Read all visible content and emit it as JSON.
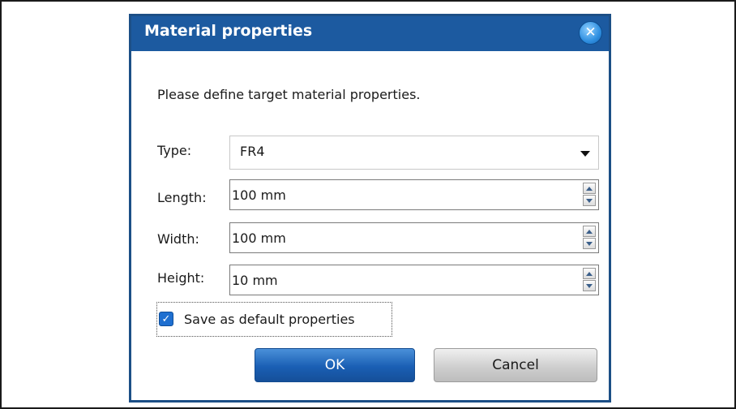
{
  "dialog": {
    "title": "Material properties",
    "close_icon": "close-icon",
    "instruction": "Please define target material properties.",
    "type": {
      "label": "Type:",
      "value": "FR4"
    },
    "length": {
      "label": "Length:",
      "value": "100 mm"
    },
    "width": {
      "label": "Width:",
      "value": "100 mm"
    },
    "height": {
      "label": "Height:",
      "value": "10 mm"
    },
    "save_default": {
      "label": "Save as default properties",
      "checked": true
    },
    "ok_label": "OK",
    "cancel_label": "Cancel"
  },
  "colors": {
    "titlebar": "#1c5aa0",
    "accent": "#1a5fb4"
  }
}
